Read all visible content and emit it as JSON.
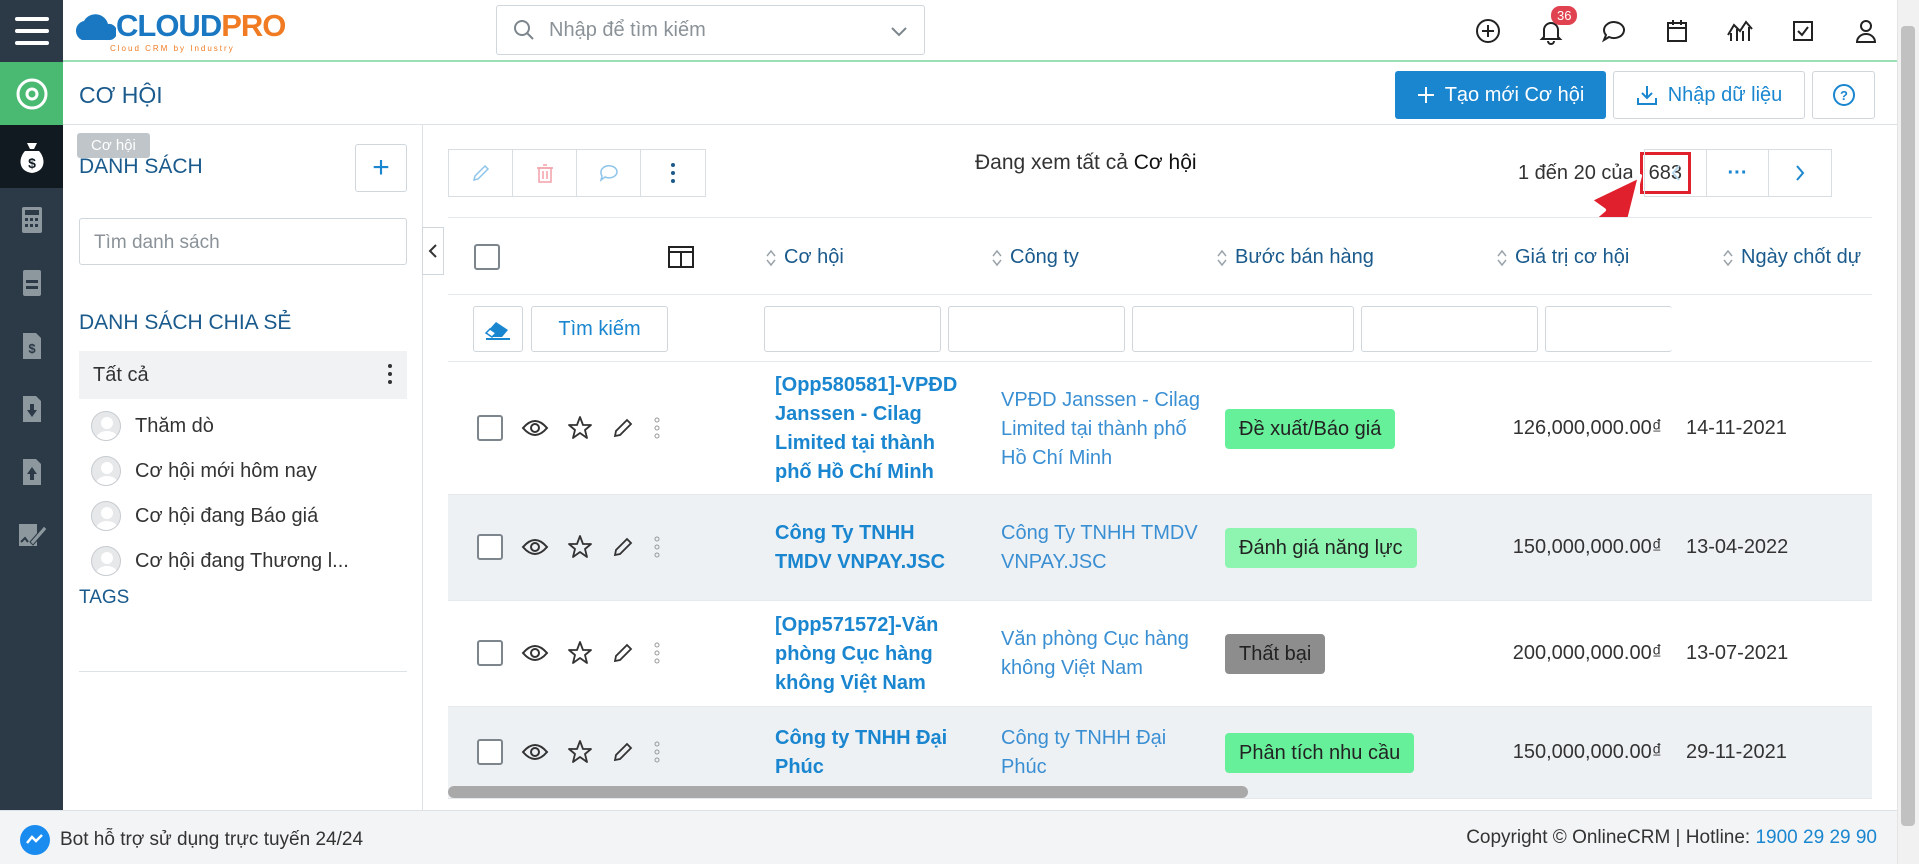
{
  "app": {
    "logo_main": "CLOUD",
    "logo_accent": "PRO",
    "logo_sub": "Cloud CRM by Industry"
  },
  "search": {
    "placeholder": "Nhập để tìm kiếm"
  },
  "topbar": {
    "notifications_count": "36",
    "icons": [
      "plus-circle-icon",
      "bell-icon",
      "chat-icon",
      "calendar-icon",
      "chart-icon",
      "checkbox-icon",
      "user-icon"
    ]
  },
  "page": {
    "title": "CƠ HỘI",
    "create_button": "Tạo mới Cơ hội",
    "import_button": "Nhập dữ liệu"
  },
  "left_panel": {
    "tooltip": "Cơ hội",
    "list_heading": "DANH SÁCH",
    "search_placeholder": "Tìm danh sách",
    "shared_heading": "DANH SÁCH CHIA SẺ",
    "all_label": "Tất cả",
    "items": [
      "Thăm dò",
      "Cơ hội mới hôm nay",
      "Cơ hội đang Báo giá",
      "Cơ hội đang Thương l..."
    ],
    "tags_heading": "TAGS"
  },
  "toolbar": {
    "viewing_prefix": "Đang xem tất cả",
    "viewing_module": "Cơ hội"
  },
  "pagination": {
    "range_text": "1 đến 20 của",
    "total": "683",
    "more": "···"
  },
  "table": {
    "columns": [
      "Cơ hội",
      "Công ty",
      "Bước bán hàng",
      "Giá trị cơ hội",
      "Ngày chốt dự"
    ],
    "search_button": "Tìm kiếm",
    "rows": [
      {
        "opportunity": "[Opp580581]-VPĐD Janssen - Cilag Limited tại thành phố Hồ Chí Minh",
        "company": "VPĐD Janssen - Cilag Limited tại thành phố Hồ Chí Minh",
        "stage": "Đề xuất/Báo giá",
        "stage_color": "#67f09a",
        "value": "126,000,000.00₫",
        "date": "14-11-2021"
      },
      {
        "opportunity": "Công Ty TNHH TMDV VNPAY.JSC",
        "company": "Công Ty TNHH TMDV VNPAY.JSC",
        "stage": "Đánh giá năng lực",
        "stage_color": "#8ef5b0",
        "value": "150,000,000.00₫",
        "date": "13-04-2022"
      },
      {
        "opportunity": "[Opp571572]-Văn phòng Cục hàng không Việt Nam",
        "company": "Văn phòng Cục hàng không Việt Nam",
        "stage": "Thất bại",
        "stage_color": "#8d8d8d",
        "value": "200,000,000.00₫",
        "date": "13-07-2021"
      },
      {
        "opportunity": "Công ty TNHH Đại Phúc",
        "company": "Công ty TNHH Đại Phúc",
        "stage": "Phân tích nhu cầu",
        "stage_color": "#67f09a",
        "value": "150,000,000.00₫",
        "date": "29-11-2021"
      }
    ]
  },
  "footer": {
    "bot_text": "Bot hỗ trợ sử dụng trực tuyến 24/24",
    "copyright": "Copyright © OnlineCRM",
    "hotline_label": "Hotline:",
    "hotline": "1900 29 29 90"
  }
}
